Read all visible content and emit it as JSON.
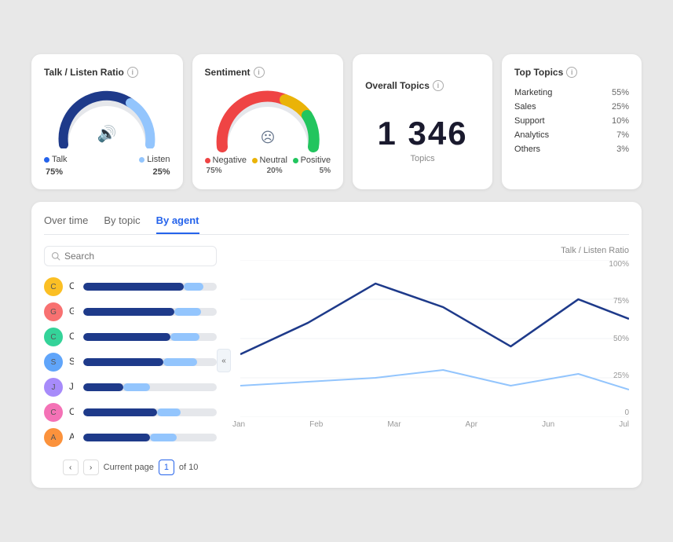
{
  "cards": {
    "talkListen": {
      "title": "Talk / Listen Ratio",
      "talk": {
        "label": "Talk",
        "value": "75%",
        "pct": 75
      },
      "listen": {
        "label": "Listen",
        "value": "25%",
        "pct": 25
      }
    },
    "sentiment": {
      "title": "Sentiment",
      "negative": {
        "label": "Negative",
        "value": "75%",
        "pct": 75
      },
      "neutral": {
        "label": "Neutral",
        "value": "20%",
        "pct": 20
      },
      "positive": {
        "label": "Positive",
        "value": "5%",
        "pct": 5
      }
    },
    "overallTopics": {
      "title": "Overall Topics",
      "number": "1 346",
      "label": "Topics"
    },
    "topTopics": {
      "title": "Top Topics",
      "items": [
        {
          "name": "Marketing",
          "pct": "55%"
        },
        {
          "name": "Sales",
          "pct": "25%"
        },
        {
          "name": "Support",
          "pct": "10%"
        },
        {
          "name": "Analytics",
          "pct": "7%"
        },
        {
          "name": "Others",
          "pct": "3%"
        }
      ]
    }
  },
  "bottom": {
    "tabs": [
      "Over time",
      "By topic",
      "By agent"
    ],
    "activeTab": "By agent",
    "search": {
      "placeholder": "Search"
    },
    "chartHeader": "Talk / Listen Ratio",
    "agents": [
      {
        "name": "Cameron Williamson",
        "dark": 75,
        "light": 15
      },
      {
        "name": "Guy Hawkins",
        "dark": 68,
        "light": 20
      },
      {
        "name": "Cody Fisher",
        "dark": 65,
        "light": 22
      },
      {
        "name": "Savannah Nguyen",
        "dark": 60,
        "light": 25
      },
      {
        "name": "Jerome Bell",
        "dark": 30,
        "light": 20
      },
      {
        "name": "Courtney Henry",
        "dark": 55,
        "light": 18
      },
      {
        "name": "Annette Black",
        "dark": 50,
        "light": 20
      }
    ],
    "pagination": {
      "currentLabel": "Current page",
      "current": "1",
      "totalLabel": "of 10"
    },
    "chartXLabels": [
      "Jan",
      "Feb",
      "Mar",
      "Apr",
      "Jun",
      "Jul"
    ],
    "chartYLabels": [
      "100%",
      "75%",
      "50%",
      "25%",
      "0"
    ]
  }
}
